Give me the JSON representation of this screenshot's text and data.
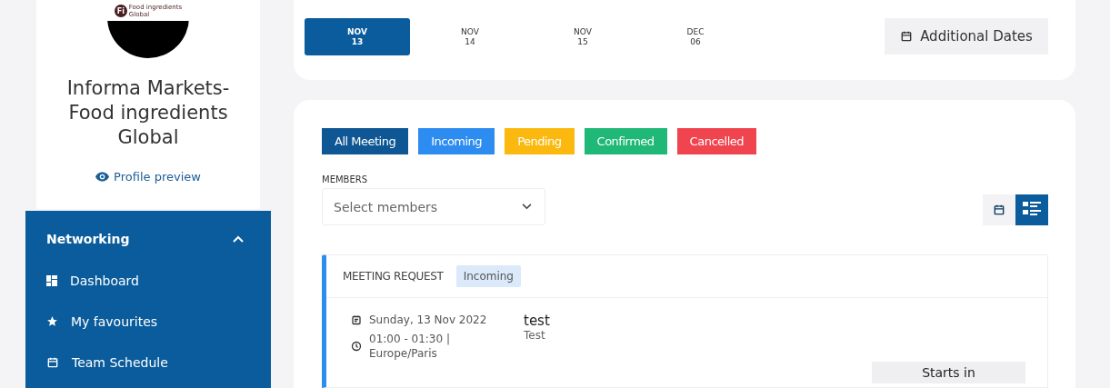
{
  "sidebar": {
    "logo": {
      "mark": "Fi",
      "line_1": "Food ingredients",
      "line_2": "Global"
    },
    "company": "Informa Markets-Food ingredients Global",
    "profile_link": "Profile preview",
    "nav": {
      "title": "Networking",
      "expanded": true,
      "items": [
        {
          "label": "Dashboard",
          "kind": "dashboard"
        },
        {
          "label": "My favourites",
          "kind": "star"
        },
        {
          "label": "Team Schedule",
          "kind": "calendar"
        }
      ]
    }
  },
  "dates": [
    {
      "month": "NOV",
      "day": "13",
      "selected": true
    },
    {
      "month": "NOV",
      "day": "14",
      "selected": false
    },
    {
      "month": "NOV",
      "day": "15",
      "selected": false
    },
    {
      "month": "DEC",
      "day": "06",
      "selected": false
    }
  ],
  "additional_dates": "Additional Dates",
  "filters": [
    {
      "label": "All Meeting",
      "color": "#0f5694"
    },
    {
      "label": "Incoming",
      "color": "#2d8cf0"
    },
    {
      "label": "Pending",
      "color": "#fbb80f"
    },
    {
      "label": "Confirmed",
      "color": "#1fb877"
    },
    {
      "label": "Cancelled",
      "color": "#f0444f"
    }
  ],
  "members": {
    "label": "MEMBERS",
    "placeholder": "Select members"
  },
  "views": [
    {
      "kind": "calendar",
      "selected": false
    },
    {
      "kind": "list",
      "selected": true
    }
  ],
  "meeting": {
    "type": "MEETING REQUEST",
    "status": "Incoming",
    "date": "Sunday, 13 Nov 2022",
    "time": "01:00 - 01:30 | Europe/Paris",
    "title": "test",
    "subtitle": "Test",
    "action": "Starts in"
  }
}
